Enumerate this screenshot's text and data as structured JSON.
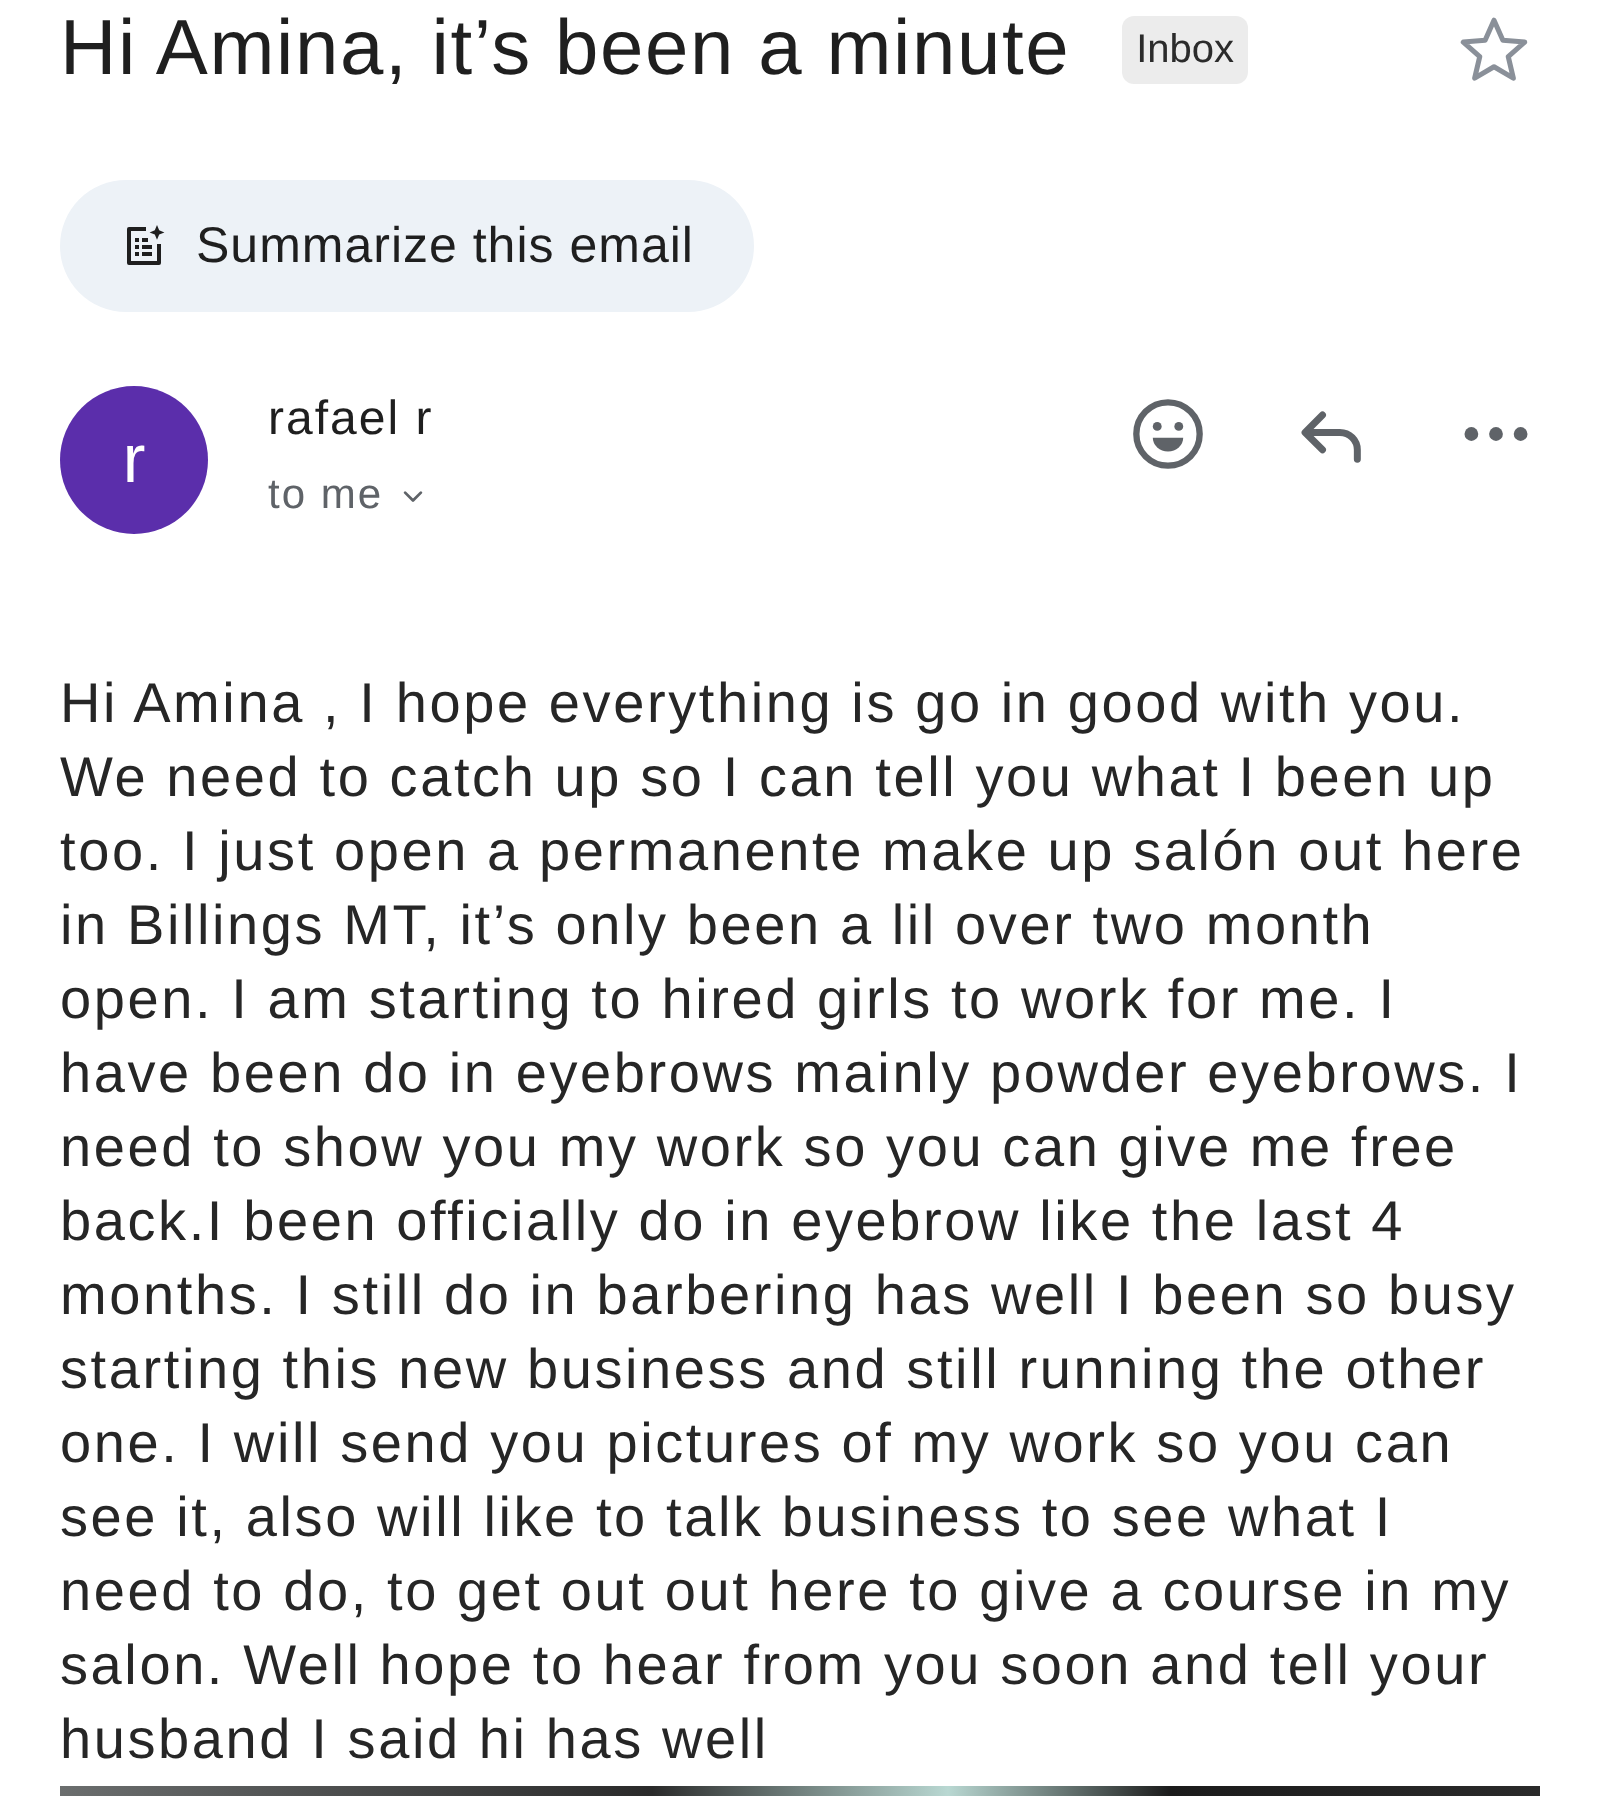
{
  "email": {
    "subject": "Hi Amina, it’s been a minute",
    "label": "Inbox",
    "starred": false
  },
  "summarize_button": {
    "label": "Summarize this email"
  },
  "message": {
    "sender": {
      "initial": "r",
      "name": "rafael r"
    },
    "recipient": "to me",
    "body": "Hi Amina , I hope everything is go in good with you. We need to catch up so I can tell you what I been up too. I just open a permanente make up salón out here in Billings MT, it’s only been a lil over two month open. I am starting to hired girls to work for me. I have been do in eyebrows mainly powder eyebrows. I need to show you my work so you can give me free back.I been officially do in eyebrow like the last 4 months. I still do in barbering has well I been so busy starting this new business and still running the other one. I will send you pictures of my work so you can see it, also will like to talk business to see what I need to do, to get out out here to give a course in my salon. Well hope to hear from you soon and tell your husband I said hi has well"
  },
  "images": [
    {
      "kind": "photo"
    }
  ]
}
